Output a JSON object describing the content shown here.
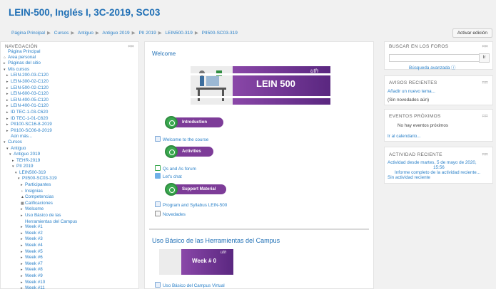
{
  "page_title": "LEIN-500, Inglés I, 3C-2019, SC03",
  "breadcrumb": [
    "Página Principal",
    "Cursos",
    "Antiguo",
    "Antiguo 2019",
    "PII 2019",
    "LEIN500-319",
    "PII500-SC03-319"
  ],
  "edit_button": "Activar edición",
  "navigation": {
    "title": "NAVEGACIÓN",
    "controls": "⌗⌗",
    "items": [
      {
        "label": "Página Principal",
        "depth": 0,
        "toggle": ""
      },
      {
        "label": "Área personal",
        "depth": 0,
        "toggle": "⌂"
      },
      {
        "label": "Páginas del sitio",
        "depth": 0,
        "toggle": "▸"
      },
      {
        "label": "Mis cursos",
        "depth": 0,
        "toggle": "▾"
      },
      {
        "label": "LEIN-200-03-C120",
        "depth": 1,
        "toggle": "▸"
      },
      {
        "label": "LEIN-300-02-C120",
        "depth": 1,
        "toggle": "▸"
      },
      {
        "label": "LEIN-500-02-C120",
        "depth": 1,
        "toggle": "▸"
      },
      {
        "label": "LEIN-600-03-C120",
        "depth": 1,
        "toggle": "▸"
      },
      {
        "label": "LEIN-400-05-C120",
        "depth": 1,
        "toggle": "▸"
      },
      {
        "label": "LEIN-400-01-C120",
        "depth": 1,
        "toggle": "▸"
      },
      {
        "label": "ID TEC-1-03-C620",
        "depth": 1,
        "toggle": "▸"
      },
      {
        "label": "ID TEC-1-01-C620",
        "depth": 1,
        "toggle": "▸"
      },
      {
        "label": "PII100-SC16-8-2019",
        "depth": 1,
        "toggle": "▸"
      },
      {
        "label": "PII100-SC06-8-2019",
        "depth": 1,
        "toggle": "▸"
      },
      {
        "label": "Aún más...",
        "depth": 1,
        "toggle": ""
      },
      {
        "label": "Cursos",
        "depth": 0,
        "toggle": "▾"
      },
      {
        "label": "Antiguo",
        "depth": 1,
        "toggle": "▾"
      },
      {
        "label": "Antiguo 2019",
        "depth": 2,
        "toggle": "▾"
      },
      {
        "label": "TEHR-2019",
        "depth": 3,
        "toggle": "▸"
      },
      {
        "label": "PII 2019",
        "depth": 3,
        "toggle": "▾"
      },
      {
        "label": "LEIN500-319",
        "depth": 4,
        "toggle": "▾"
      },
      {
        "label": "PII500-SC03-319",
        "depth": 5,
        "toggle": "▾"
      },
      {
        "label": "Participantes",
        "depth": 6,
        "toggle": "▸"
      },
      {
        "label": "Insignias",
        "depth": 6,
        "toggle": "♁"
      },
      {
        "label": "Competencias",
        "depth": 6,
        "toggle": "▲"
      },
      {
        "label": "Calificaciones",
        "depth": 6,
        "toggle": "▦"
      },
      {
        "label": "Welcome",
        "depth": 6,
        "toggle": "▸"
      },
      {
        "label": "Uso Básico de las",
        "depth": 6,
        "toggle": "▸"
      },
      {
        "label": "Herramientas del Campus",
        "depth": 6,
        "toggle": ""
      },
      {
        "label": "Week #1",
        "depth": 6,
        "toggle": "▸"
      },
      {
        "label": "Week #2",
        "depth": 6,
        "toggle": "▸"
      },
      {
        "label": "Week #3",
        "depth": 6,
        "toggle": "▸"
      },
      {
        "label": "Week #4",
        "depth": 6,
        "toggle": "▸"
      },
      {
        "label": "Week #5",
        "depth": 6,
        "toggle": "▸"
      },
      {
        "label": "Week #6",
        "depth": 6,
        "toggle": "▸"
      },
      {
        "label": "Week #7",
        "depth": 6,
        "toggle": "▸"
      },
      {
        "label": "Week #8",
        "depth": 6,
        "toggle": "▸"
      },
      {
        "label": "Week #9",
        "depth": 6,
        "toggle": "▸"
      },
      {
        "label": "Week #10",
        "depth": 6,
        "toggle": "▸"
      },
      {
        "label": "Week #11",
        "depth": 6,
        "toggle": "▸"
      }
    ]
  },
  "main": {
    "welcome_title": "Welcome",
    "banner_text": "LEIN 500",
    "banner_logo": "uth",
    "intro_label": "Introduction",
    "welcome_course": "Welcome to the course",
    "activities_label": "Activities",
    "forum": "Qs and As forum",
    "chat": "Let's chat",
    "support_label": "Support Material",
    "program": "Program and Syllabus LEIN-500",
    "news": "Novedades",
    "section2_title": "Uso Básico de las Herramientas del Campus",
    "week0": "Week # 0",
    "campus_virtual": "Uso Básico del Campus Virtual"
  },
  "search_block": {
    "title": "BUSCAR EN LOS FOROS",
    "controls": "⌗⌗",
    "go": "Ir",
    "advanced": "Búsqueda avanzada ⓘ"
  },
  "news_block": {
    "title": "AVISOS RECIENTES",
    "controls": "⌗⌗",
    "add": "Añadir un nuevo tema...",
    "none": "(Sin novedades aún)"
  },
  "events_block": {
    "title": "EVENTOS PRÓXIMOS",
    "controls": "⌗⌗",
    "none": "No hay eventos próximos",
    "calendar": "Ir al calendario..."
  },
  "activity_block": {
    "title": "ACTIVIDAD RECIENTE",
    "controls": "⌗⌗",
    "since_line1": "Actividad desde martes, 5 de mayo de 2020,",
    "since_line2": "15:56",
    "report": "Informe completo de la actividad reciente...",
    "none": "Sin actividad reciente"
  },
  "colors": {
    "link": "#2a80c8",
    "title": "#1f6fb5",
    "purple": "#7d3c98",
    "green": "#3aa84f"
  }
}
